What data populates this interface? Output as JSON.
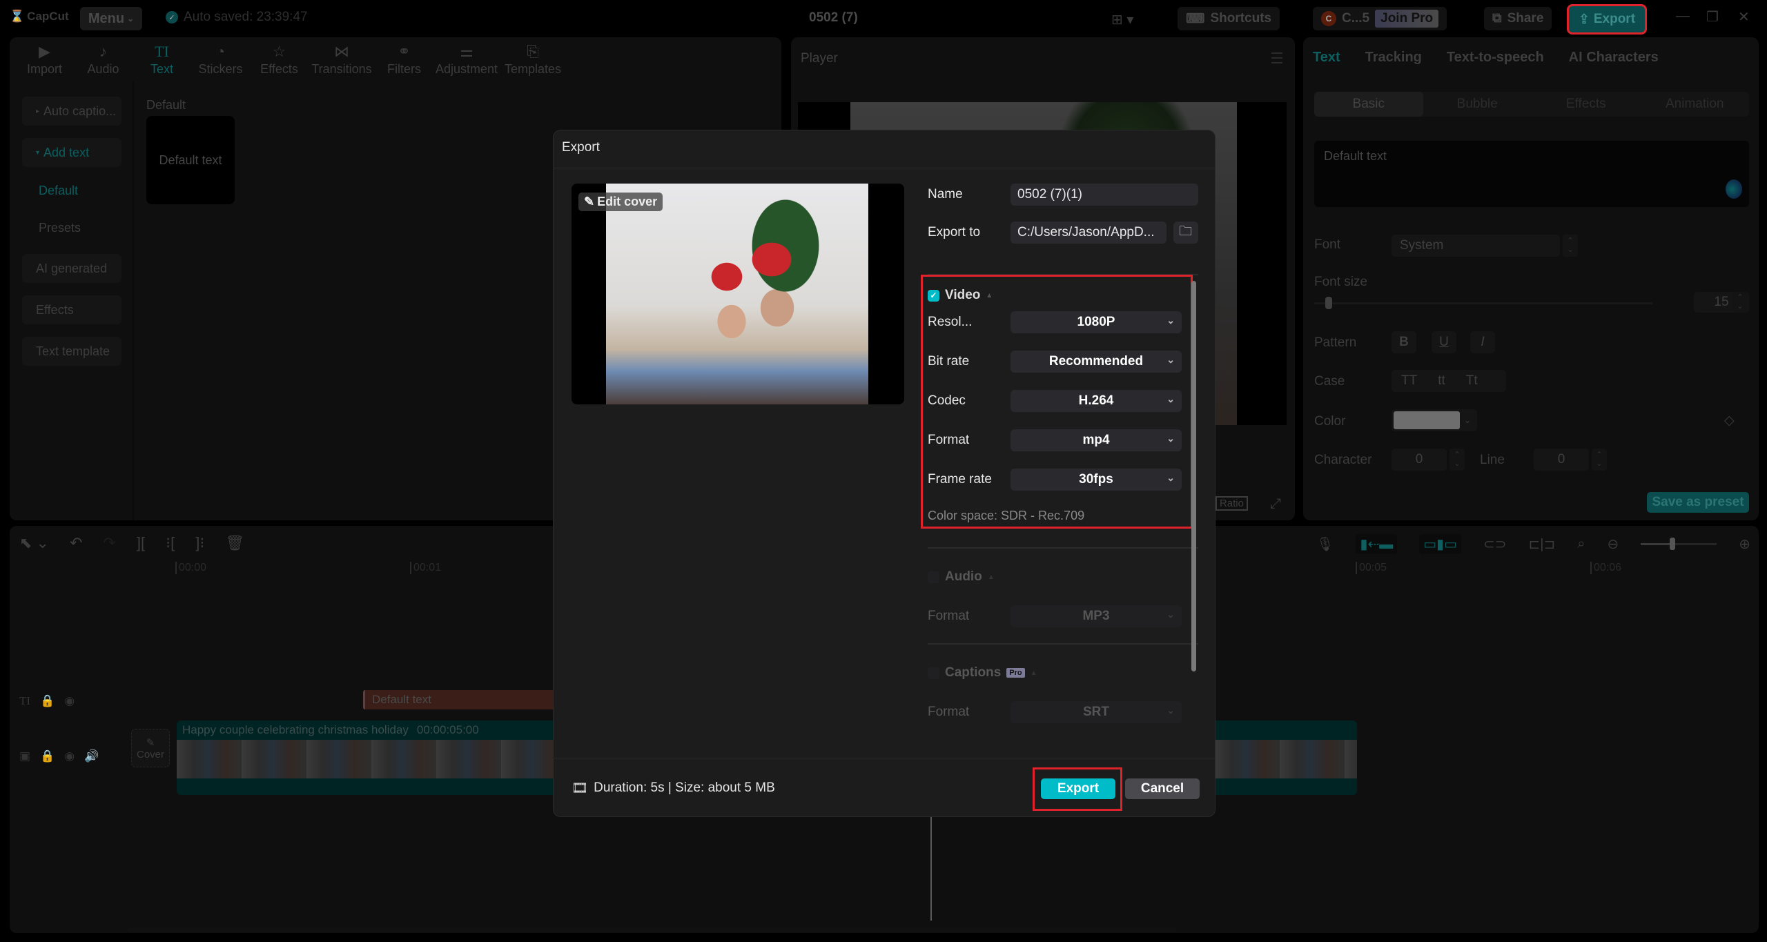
{
  "app": {
    "logo": "CapCut",
    "menu_label": "Menu",
    "autosave": "Auto saved: 23:39:47",
    "project_title": "0502 (7)",
    "shortcuts_label": "Shortcuts",
    "account_initial": "C",
    "account_name": "C...5",
    "join_pro_label": "Join Pro",
    "share_label": "Share",
    "export_label": "Export"
  },
  "toolbar": {
    "tools": [
      {
        "label": "Import",
        "icon": "import-icon"
      },
      {
        "label": "Audio",
        "icon": "audio-icon"
      },
      {
        "label": "Text",
        "icon": "text-icon",
        "active": true
      },
      {
        "label": "Stickers",
        "icon": "stickers-icon"
      },
      {
        "label": "Effects",
        "icon": "effects-icon"
      },
      {
        "label": "Transitions",
        "icon": "transitions-icon"
      },
      {
        "label": "Filters",
        "icon": "filters-icon"
      },
      {
        "label": "Adjustment",
        "icon": "adjustment-icon"
      },
      {
        "label": "Templates",
        "icon": "templates-icon"
      }
    ]
  },
  "subnav": {
    "auto_captions": "Auto captio...",
    "add_text": "Add text",
    "default": "Default",
    "presets": "Presets",
    "ai_generated": "AI generated",
    "effects": "Effects",
    "text_template": "Text template"
  },
  "content": {
    "section_label": "Default",
    "card_text": "Default text"
  },
  "player": {
    "title": "Player",
    "ratio_label": "Ratio"
  },
  "inspector": {
    "tabs": [
      "Text",
      "Tracking",
      "Text-to-speech",
      "AI Characters"
    ],
    "subtabs": [
      "Basic",
      "Bubble",
      "Effects",
      "Animation"
    ],
    "text_value": "Default text",
    "font_label": "Font",
    "font_value": "System",
    "font_size_label": "Font size",
    "font_size_value": "15",
    "pattern_label": "Pattern",
    "pattern_buttons": [
      "B",
      "U",
      "I"
    ],
    "case_label": "Case",
    "case_buttons": [
      "TT",
      "tt",
      "Tt"
    ],
    "color_label": "Color",
    "color_value": "#6e6e6e",
    "character_label": "Character",
    "character_value": "0",
    "line_label": "Line",
    "line_value": "0",
    "save_preset_label": "Save as preset"
  },
  "timeline": {
    "ruler": [
      "00:00",
      "00:01",
      "00:05",
      "00:06"
    ],
    "text_clip": "Default text",
    "video_clip_name": "Happy couple celebrating christmas holiday",
    "video_clip_duration": "00:00:05:00",
    "cover_label": "Cover"
  },
  "export_dialog": {
    "title": "Export",
    "edit_cover_label": "Edit cover",
    "name_label": "Name",
    "name_value": "0502 (7)(1)",
    "export_to_label": "Export to",
    "export_to_value": "C:/Users/Jason/AppD...",
    "video": {
      "label": "Video",
      "checked": true,
      "resolution_label": "Resol...",
      "resolution_value": "1080P",
      "bitrate_label": "Bit rate",
      "bitrate_value": "Recommended",
      "codec_label": "Codec",
      "codec_value": "H.264",
      "format_label": "Format",
      "format_value": "mp4",
      "framerate_label": "Frame rate",
      "framerate_value": "30fps",
      "color_space": "Color space: SDR - Rec.709"
    },
    "audio": {
      "label": "Audio",
      "checked": false,
      "format_label": "Format",
      "format_value": "MP3"
    },
    "captions": {
      "label": "Captions",
      "badge": "Pro",
      "checked": false,
      "format_label": "Format",
      "format_value": "SRT"
    },
    "footer_info": "Duration: 5s | Size: about 5 MB",
    "export_button": "Export",
    "cancel_button": "Cancel"
  },
  "colors": {
    "accent": "#00bcc8",
    "highlight_box": "#e0232a",
    "dim_accent": "#0b4d4e"
  }
}
